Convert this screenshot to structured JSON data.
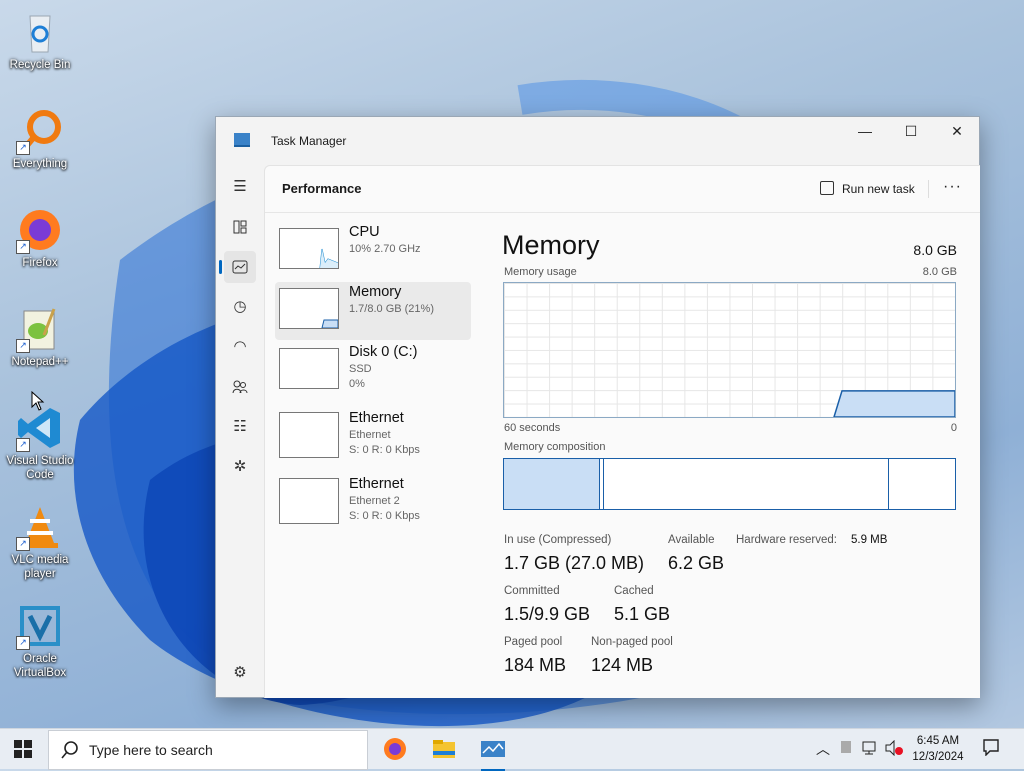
{
  "desktop": {
    "icons": [
      {
        "label": "Recycle Bin",
        "icon": "recycle-bin-icon"
      },
      {
        "label": "Everything",
        "icon": "everything-search-icon"
      },
      {
        "label": "Firefox",
        "icon": "firefox-icon"
      },
      {
        "label": "Notepad++",
        "icon": "notepad-plus-plus-icon"
      },
      {
        "label": "Visual Studio Code",
        "icon": "vscode-icon"
      },
      {
        "label": "VLC media player",
        "icon": "vlc-icon"
      },
      {
        "label": "Oracle VirtualBox",
        "icon": "virtualbox-icon"
      }
    ]
  },
  "window": {
    "title": "Task Manager",
    "controls": {
      "minimize": "—",
      "maximize": "☐",
      "close": "✕"
    }
  },
  "nav": {
    "items": [
      "menu-icon",
      "processes-icon",
      "performance-icon",
      "app-history-icon",
      "startup-apps-icon",
      "users-icon",
      "details-icon",
      "services-icon"
    ],
    "active": "performance-icon",
    "settings": "settings-icon"
  },
  "header": {
    "title": "Performance",
    "run_new_task": "Run new task",
    "more": "···"
  },
  "devices": [
    {
      "name": "CPU",
      "sub1": "10% 2.70 GHz",
      "sub2": "",
      "selected": false
    },
    {
      "name": "Memory",
      "sub1": "1.7/8.0 GB (21%)",
      "sub2": "",
      "selected": true
    },
    {
      "name": "Disk 0 (C:)",
      "sub1": "SSD",
      "sub2": "0%",
      "selected": false
    },
    {
      "name": "Ethernet",
      "sub1": "Ethernet",
      "sub2": "S: 0 R: 0 Kbps",
      "selected": false
    },
    {
      "name": "Ethernet",
      "sub1": "Ethernet 2",
      "sub2": "S: 0 R: 0 Kbps",
      "selected": false
    }
  ],
  "detail": {
    "title": "Memory",
    "total": "8.0 GB",
    "usage_label": "Memory usage",
    "usage_max": "8.0 GB",
    "time_left": "60 seconds",
    "time_right": "0",
    "composition_label": "Memory composition",
    "in_use_level": 0.21,
    "stats": {
      "in_use_label": "In use (Compressed)",
      "in_use": "1.7 GB (27.0 MB)",
      "available_label": "Available",
      "available": "6.2 GB",
      "hw_reserved_label": "Hardware reserved:",
      "hw_reserved": "5.9 MB",
      "committed_label": "Committed",
      "committed": "1.5/9.9 GB",
      "cached_label": "Cached",
      "cached": "5.1 GB",
      "paged_label": "Paged pool",
      "paged": "184 MB",
      "nonpaged_label": "Non-paged pool",
      "nonpaged": "124 MB"
    }
  },
  "taskbar": {
    "search_placeholder": "Type here to search",
    "apps": [
      "firefox-icon",
      "file-explorer-icon",
      "task-manager-icon"
    ],
    "time": "6:45 AM",
    "date": "12/3/2024"
  },
  "colors": {
    "accent": "#0067c0",
    "memory_line": "#1a5fa8",
    "memory_fill": "#c9def5",
    "cpu_line": "#1c8bd0"
  }
}
